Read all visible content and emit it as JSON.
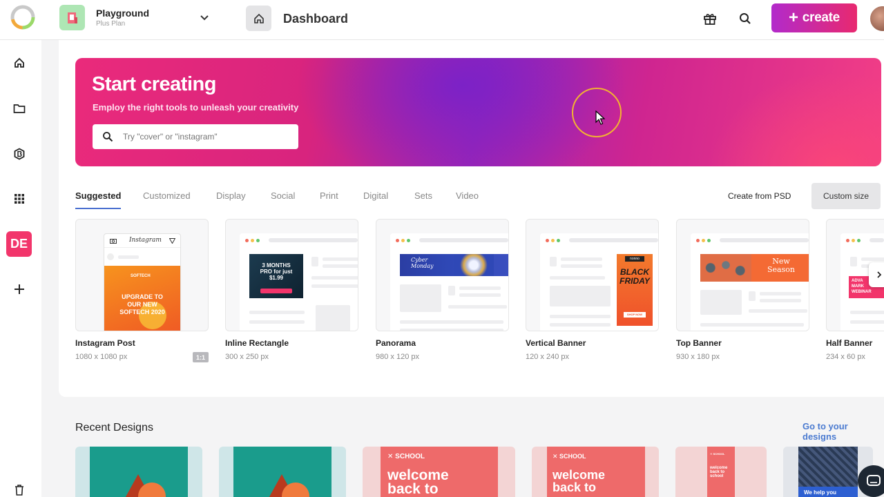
{
  "colors": {
    "accent": "#f2356b",
    "link": "#4a7ad0",
    "tab_underline": "#4a6fd0",
    "create_from": "#b22acb",
    "create_to": "#e8296f"
  },
  "header": {
    "workspace_name": "Playground",
    "workspace_plan": "Plus Plan",
    "page_title": "Dashboard",
    "create_label": "create",
    "create_plus": "+"
  },
  "sidebar": {
    "items": [
      {
        "name": "home-icon"
      },
      {
        "name": "folder-icon"
      },
      {
        "name": "brand-icon"
      },
      {
        "name": "apps-grid-icon"
      },
      {
        "name": "workspace-badge",
        "label": "DE"
      },
      {
        "name": "plus-icon"
      },
      {
        "name": "trash-icon"
      }
    ]
  },
  "hero": {
    "title": "Start creating",
    "subtitle": "Employ the right tools to unleash your creativity",
    "search_placeholder": "Try \"cover\" or \"instagram\""
  },
  "tabs": [
    {
      "label": "Suggested",
      "active": true
    },
    {
      "label": "Customized"
    },
    {
      "label": "Display"
    },
    {
      "label": "Social"
    },
    {
      "label": "Print"
    },
    {
      "label": "Digital"
    },
    {
      "label": "Sets"
    },
    {
      "label": "Video"
    }
  ],
  "actions": {
    "create_from_psd": "Create from PSD",
    "custom_size": "Custom size"
  },
  "templates": [
    {
      "name": "Instagram Post",
      "dims": "1080 x 1080 px",
      "badge": "1:1",
      "preview": {
        "app": "Instagram",
        "brand": "SOFTECH",
        "line1": "UPGRADE TO",
        "line2": "OUR NEW",
        "line3": "SOFTECH 2020"
      }
    },
    {
      "name": "Inline Rectangle",
      "dims": "300 x 250 px",
      "preview": {
        "line1": "3 MONTHS",
        "line2": "PRO for just",
        "line3": "$1.99"
      }
    },
    {
      "name": "Panorama",
      "dims": "980 x 120 px",
      "preview": {
        "line1": "Cyber",
        "line2": "Monday"
      }
    },
    {
      "name": "Vertical Banner",
      "dims": "120 x 240 px",
      "preview": {
        "brand": "nonno",
        "line1": "BLACK",
        "line2": "FRIDAY",
        "cta": "SHOP NOW"
      }
    },
    {
      "name": "Top Banner",
      "dims": "930 x 180 px",
      "preview": {
        "line1": "New",
        "line2": "Season"
      }
    },
    {
      "name": "Half Banner",
      "dims": "234 x 60 px",
      "preview": {
        "line1": "ADVA",
        "line2": "MARK",
        "line3": "WEBINAR"
      }
    }
  ],
  "recent": {
    "title": "Recent Designs",
    "go_link": "Go to your designs",
    "items": [
      {
        "kind": "teal"
      },
      {
        "kind": "teal"
      },
      {
        "kind": "school",
        "brand": "SCHOOL",
        "line1": "welcome",
        "line2": "back to"
      },
      {
        "kind": "school",
        "brand": "SCHOOL",
        "line1": "welcome",
        "line2": "back to"
      },
      {
        "kind": "school-small",
        "brand": "SCHOOL",
        "line1": "welcome",
        "line2": "back to",
        "line3": "school"
      },
      {
        "kind": "dark",
        "line1": "We help you"
      }
    ]
  }
}
